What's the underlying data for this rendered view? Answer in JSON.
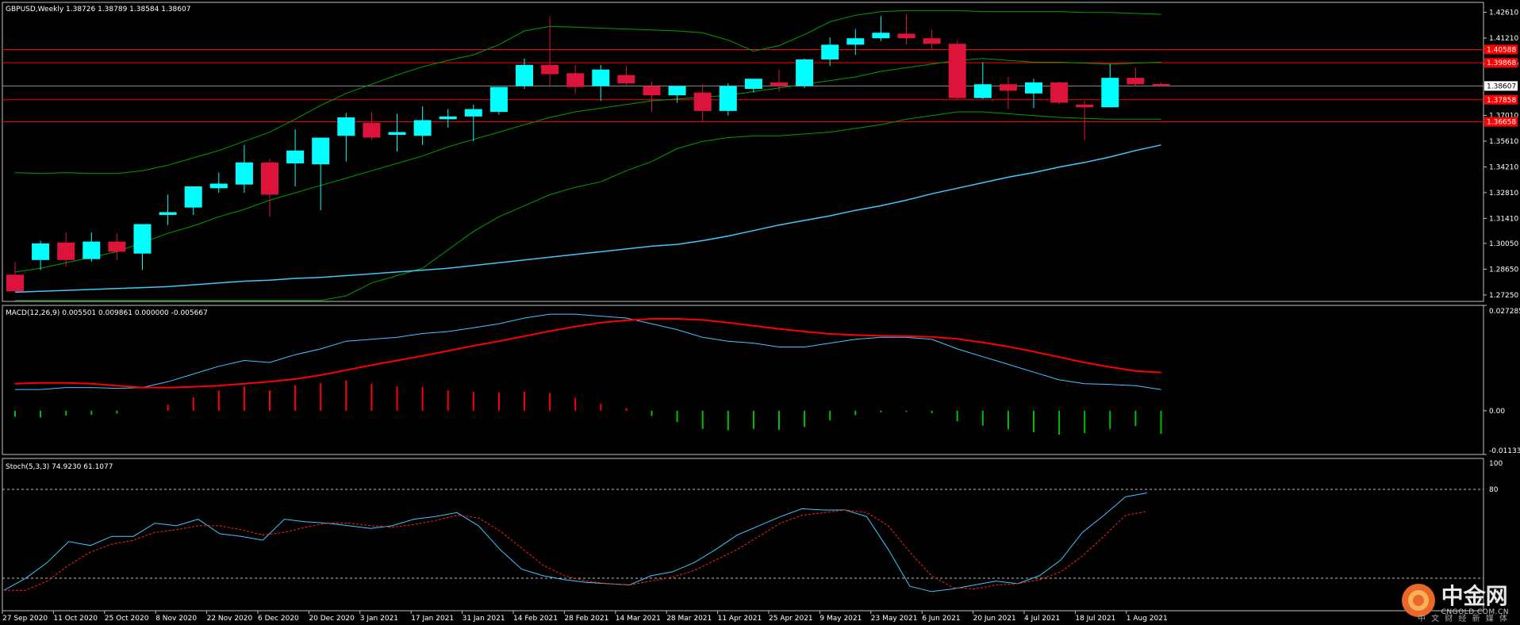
{
  "symbol_header": "GBPUSD,Weekly  1.38726 1.38789 1.38584 1.38607",
  "colors": {
    "bull": "#00ffff",
    "bear": "#dc143c",
    "grid_frame": "#c0c0c0",
    "bb": "#00a000",
    "ma": "#40c8ff",
    "hline": "#ff0000",
    "macd_main": "#40c8ff",
    "macd_signal": "#ff0000",
    "hist_pos": "#ff0000",
    "hist_neg": "#00c000",
    "stoch_main": "#40c8ff",
    "stoch_signal": "#ff2020"
  },
  "price_axis": {
    "ticks": [
      "1.42610",
      "1.41210",
      "1.39810",
      "1.37010",
      "1.35610",
      "1.34210",
      "1.32810",
      "1.31410",
      "1.30050",
      "1.28650",
      "1.27250"
    ],
    "current_price": "1.38607",
    "level_tags": [
      "1.40588",
      "1.39868",
      "1.37858",
      "1.36658"
    ]
  },
  "macd": {
    "header": "MACD(12,26,9) 0.005501 0.009861 0.000000 -0.005667",
    "axis": [
      "0.027285",
      "0.00",
      "-0.011331"
    ]
  },
  "stoch": {
    "header": "Stoch(5,3,3) 74.9230 61.1077",
    "axis": [
      "100",
      "80",
      "20"
    ]
  },
  "time_axis": [
    "27 Sep 2020",
    "11 Oct 2020",
    "25 Oct 2020",
    "8 Nov 2020",
    "22 Nov 2020",
    "6 Dec 2020",
    "20 Dec 2020",
    "3 Jan 2021",
    "17 Jan 2021",
    "31 Jan 2021",
    "14 Feb 2021",
    "28 Feb 2021",
    "14 Mar 2021",
    "28 Mar 2021",
    "11 Apr 2021",
    "25 Apr 2021",
    "9 May 2021",
    "23 May 2021",
    "6 Jun 2021",
    "20 Jun 2021",
    "4 Jul 2021",
    "18 Jul 2021",
    "1 Aug 2021"
  ],
  "watermark": {
    "brand": "中金网",
    "domain": "CNGOLD.COM.CN",
    "slogan": "中 文 财 经 新 媒 体"
  },
  "chart_data": {
    "type": "candlestick",
    "timeframe": "Weekly",
    "candles": [
      {
        "o": 1.2835,
        "h": 1.2905,
        "l": 1.274,
        "c": 1.2745
      },
      {
        "o": 1.2915,
        "h": 1.302,
        "l": 1.286,
        "c": 1.3005
      },
      {
        "o": 1.301,
        "h": 1.3065,
        "l": 1.288,
        "c": 1.2915
      },
      {
        "o": 1.292,
        "h": 1.3065,
        "l": 1.2905,
        "c": 1.3015
      },
      {
        "o": 1.3015,
        "h": 1.306,
        "l": 1.2915,
        "c": 1.296
      },
      {
        "o": 1.295,
        "h": 1.311,
        "l": 1.286,
        "c": 1.311
      },
      {
        "o": 1.316,
        "h": 1.327,
        "l": 1.3105,
        "c": 1.3175
      },
      {
        "o": 1.32,
        "h": 1.331,
        "l": 1.316,
        "c": 1.3315
      },
      {
        "o": 1.3305,
        "h": 1.339,
        "l": 1.328,
        "c": 1.333
      },
      {
        "o": 1.3325,
        "h": 1.354,
        "l": 1.328,
        "c": 1.3445
      },
      {
        "o": 1.3445,
        "h": 1.3465,
        "l": 1.315,
        "c": 1.327
      },
      {
        "o": 1.344,
        "h": 1.3625,
        "l": 1.3315,
        "c": 1.351
      },
      {
        "o": 1.3435,
        "h": 1.357,
        "l": 1.3185,
        "c": 1.358
      },
      {
        "o": 1.359,
        "h": 1.3715,
        "l": 1.345,
        "c": 1.369
      },
      {
        "o": 1.366,
        "h": 1.372,
        "l": 1.3565,
        "c": 1.358
      },
      {
        "o": 1.3595,
        "h": 1.371,
        "l": 1.3505,
        "c": 1.361
      },
      {
        "o": 1.359,
        "h": 1.375,
        "l": 1.354,
        "c": 1.3675
      },
      {
        "o": 1.368,
        "h": 1.3735,
        "l": 1.3635,
        "c": 1.3695
      },
      {
        "o": 1.3695,
        "h": 1.376,
        "l": 1.356,
        "c": 1.3735
      },
      {
        "o": 1.372,
        "h": 1.382,
        "l": 1.3705,
        "c": 1.3855
      },
      {
        "o": 1.386,
        "h": 1.401,
        "l": 1.3845,
        "c": 1.3975
      },
      {
        "o": 1.3975,
        "h": 1.424,
        "l": 1.386,
        "c": 1.3925
      },
      {
        "o": 1.393,
        "h": 1.3975,
        "l": 1.382,
        "c": 1.3855
      },
      {
        "o": 1.386,
        "h": 1.3975,
        "l": 1.378,
        "c": 1.395
      },
      {
        "o": 1.392,
        "h": 1.397,
        "l": 1.386,
        "c": 1.3875
      },
      {
        "o": 1.386,
        "h": 1.3885,
        "l": 1.372,
        "c": 1.381
      },
      {
        "o": 1.381,
        "h": 1.386,
        "l": 1.377,
        "c": 1.386
      },
      {
        "o": 1.3825,
        "h": 1.387,
        "l": 1.367,
        "c": 1.3725
      },
      {
        "o": 1.3725,
        "h": 1.3875,
        "l": 1.37,
        "c": 1.386
      },
      {
        "o": 1.3845,
        "h": 1.389,
        "l": 1.3825,
        "c": 1.39
      },
      {
        "o": 1.388,
        "h": 1.395,
        "l": 1.383,
        "c": 1.386
      },
      {
        "o": 1.386,
        "h": 1.401,
        "l": 1.385,
        "c": 1.4005
      },
      {
        "o": 1.4005,
        "h": 1.4125,
        "l": 1.397,
        "c": 1.4085
      },
      {
        "o": 1.4085,
        "h": 1.417,
        "l": 1.403,
        "c": 1.412
      },
      {
        "o": 1.412,
        "h": 1.424,
        "l": 1.4105,
        "c": 1.415
      },
      {
        "o": 1.4145,
        "h": 1.425,
        "l": 1.4085,
        "c": 1.412
      },
      {
        "o": 1.412,
        "h": 1.4165,
        "l": 1.406,
        "c": 1.409
      },
      {
        "o": 1.409,
        "h": 1.411,
        "l": 1.3785,
        "c": 1.3795
      },
      {
        "o": 1.3795,
        "h": 1.399,
        "l": 1.379,
        "c": 1.387
      },
      {
        "o": 1.387,
        "h": 1.391,
        "l": 1.3735,
        "c": 1.3835
      },
      {
        "o": 1.382,
        "h": 1.39,
        "l": 1.374,
        "c": 1.388
      },
      {
        "o": 1.388,
        "h": 1.3885,
        "l": 1.376,
        "c": 1.377
      },
      {
        "o": 1.376,
        "h": 1.378,
        "l": 1.3565,
        "c": 1.3745
      },
      {
        "o": 1.3745,
        "h": 1.398,
        "l": 1.3745,
        "c": 1.3905
      },
      {
        "o": 1.3905,
        "h": 1.396,
        "l": 1.386,
        "c": 1.387
      },
      {
        "o": 1.3872,
        "h": 1.3879,
        "l": 1.3858,
        "c": 1.3861
      }
    ],
    "ma_line": [
      1.274,
      1.2745,
      1.275,
      1.2755,
      1.276,
      1.2765,
      1.277,
      1.278,
      1.279,
      1.28,
      1.2805,
      1.2815,
      1.282,
      1.283,
      1.284,
      1.285,
      1.286,
      1.287,
      1.2885,
      1.29,
      1.2915,
      1.293,
      1.2945,
      1.296,
      1.2975,
      1.299,
      1.3,
      1.302,
      1.3045,
      1.3075,
      1.3105,
      1.313,
      1.3155,
      1.3185,
      1.321,
      1.324,
      1.3275,
      1.3305,
      1.3335,
      1.3365,
      1.339,
      1.342,
      1.3445,
      1.3475,
      1.351,
      1.354
    ],
    "bb_upper": [
      1.339,
      1.3385,
      1.339,
      1.3385,
      1.3385,
      1.34,
      1.343,
      1.347,
      1.351,
      1.356,
      1.361,
      1.368,
      1.3755,
      1.382,
      1.387,
      1.392,
      1.3965,
      1.4,
      1.403,
      1.4085,
      1.416,
      1.4185,
      1.418,
      1.4175,
      1.417,
      1.4165,
      1.416,
      1.415,
      1.411,
      1.405,
      1.408,
      1.414,
      1.421,
      1.4245,
      1.4265,
      1.427,
      1.427,
      1.427,
      1.4265,
      1.4265,
      1.4265,
      1.4265,
      1.426,
      1.426,
      1.4255,
      1.425
    ],
    "bb_middle": [
      1.285,
      1.287,
      1.29,
      1.293,
      1.296,
      1.301,
      1.306,
      1.31,
      1.315,
      1.319,
      1.324,
      1.328,
      1.332,
      1.336,
      1.34,
      1.344,
      1.348,
      1.353,
      1.357,
      1.361,
      1.365,
      1.369,
      1.372,
      1.374,
      1.376,
      1.378,
      1.379,
      1.38,
      1.381,
      1.383,
      1.385,
      1.387,
      1.389,
      1.391,
      1.394,
      1.396,
      1.398,
      1.4,
      1.401,
      1.4,
      1.399,
      1.399,
      1.3985,
      1.398,
      1.3985,
      1.399
    ],
    "bb_lower": [
      1.261,
      1.26,
      1.2595,
      1.259,
      1.257,
      1.2545,
      1.252,
      1.249,
      1.247,
      1.2485,
      1.251,
      1.256,
      1.264,
      1.272,
      1.279,
      1.283,
      1.287,
      1.297,
      1.307,
      1.315,
      1.321,
      1.327,
      1.331,
      1.334,
      1.34,
      1.345,
      1.352,
      1.356,
      1.358,
      1.359,
      1.359,
      1.36,
      1.361,
      1.363,
      1.365,
      1.368,
      1.37,
      1.372,
      1.372,
      1.371,
      1.37,
      1.369,
      1.3685,
      1.368,
      1.368,
      1.368
    ],
    "levels": [
      1.40588,
      1.39868,
      1.37858,
      1.36658
    ],
    "macd_main": [
      0.0055,
      0.0055,
      0.006,
      0.006,
      0.0058,
      0.006,
      0.0075,
      0.0095,
      0.0115,
      0.013,
      0.0125,
      0.0145,
      0.016,
      0.018,
      0.0185,
      0.019,
      0.02,
      0.0205,
      0.0215,
      0.0225,
      0.024,
      0.025,
      0.025,
      0.0245,
      0.024,
      0.0225,
      0.021,
      0.019,
      0.018,
      0.0175,
      0.0165,
      0.0165,
      0.0175,
      0.0185,
      0.019,
      0.019,
      0.0185,
      0.016,
      0.014,
      0.012,
      0.01,
      0.008,
      0.007,
      0.0068,
      0.0065,
      0.0055
    ],
    "macd_signal": [
      0.007,
      0.0072,
      0.0072,
      0.007,
      0.0065,
      0.006,
      0.006,
      0.0062,
      0.0065,
      0.007,
      0.0075,
      0.0082,
      0.0092,
      0.0105,
      0.0118,
      0.013,
      0.0142,
      0.0155,
      0.0168,
      0.018,
      0.0193,
      0.0206,
      0.0218,
      0.0228,
      0.0234,
      0.0238,
      0.0238,
      0.0235,
      0.0228,
      0.022,
      0.0212,
      0.0205,
      0.0199,
      0.0196,
      0.0194,
      0.0193,
      0.0191,
      0.0186,
      0.0177,
      0.0166,
      0.0153,
      0.0139,
      0.0125,
      0.0113,
      0.0103,
      0.0099
    ],
    "macd_hist": [
      -0.0015,
      -0.0017,
      -0.0012,
      -0.001,
      -0.0007,
      0.0,
      0.0015,
      0.0033,
      0.005,
      0.006,
      0.005,
      0.0063,
      0.0068,
      0.0075,
      0.0067,
      0.006,
      0.0058,
      0.005,
      0.0047,
      0.0045,
      0.0047,
      0.0044,
      0.0032,
      0.0017,
      0.0006,
      -0.0013,
      -0.0028,
      -0.0045,
      -0.0048,
      -0.0045,
      -0.0047,
      -0.004,
      -0.0024,
      -0.0011,
      -0.0004,
      -0.0003,
      -0.0006,
      -0.0026,
      -0.0037,
      -0.0046,
      -0.0053,
      -0.0059,
      -0.0055,
      -0.0045,
      -0.0038,
      -0.0057
    ],
    "stoch_main": [
      1,
      10,
      22,
      38,
      35,
      42,
      42,
      52,
      50,
      55,
      44,
      42,
      39,
      55,
      53,
      52,
      50,
      48,
      50,
      55,
      57,
      60,
      50,
      32,
      17,
      12,
      9,
      7,
      6,
      5,
      12,
      15,
      22,
      32,
      43,
      50,
      57,
      63,
      62,
      62,
      57,
      32,
      4,
      0,
      2,
      5,
      8,
      6,
      12,
      24,
      45,
      58,
      72,
      75
    ],
    "stoch_signal": [
      1,
      1,
      8,
      20,
      30,
      36,
      39,
      45,
      47,
      50,
      50,
      47,
      43,
      45,
      49,
      52,
      52,
      50,
      49,
      51,
      54,
      58,
      56,
      46,
      33,
      20,
      12,
      8,
      6,
      5,
      8,
      11,
      16,
      24,
      32,
      42,
      52,
      58,
      60,
      62,
      60,
      50,
      30,
      12,
      3,
      2,
      5,
      6,
      9,
      15,
      27,
      42,
      58,
      61
    ]
  }
}
